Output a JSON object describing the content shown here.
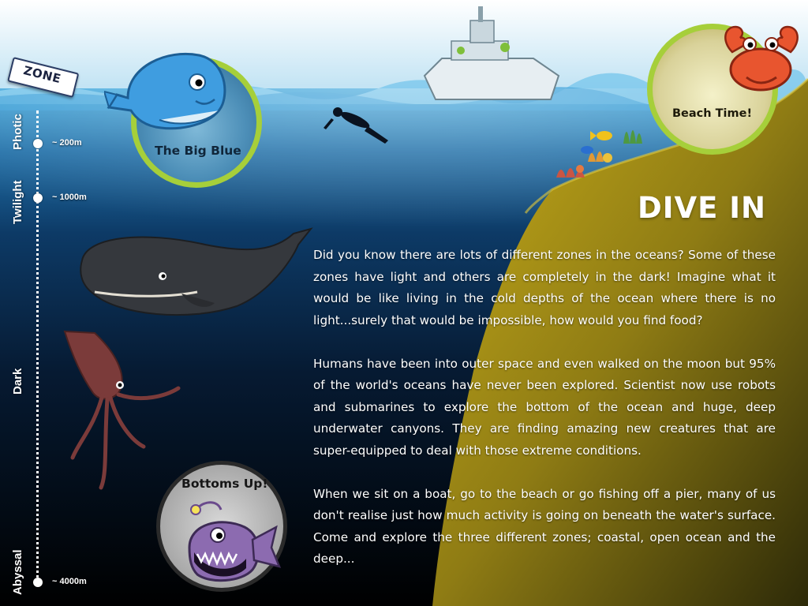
{
  "zone_tag": "ZONE",
  "zones": [
    {
      "name": "Photic",
      "depth": "~ 200m"
    },
    {
      "name": "Twilight",
      "depth": "~ 1000m"
    },
    {
      "name": "Dark",
      "depth": ""
    },
    {
      "name": "Abyssal",
      "depth": "~ 4000m"
    }
  ],
  "nav": {
    "big_blue": "The Big Blue",
    "beach_time": "Beach Time!",
    "bottoms_up": "Bottoms Up!"
  },
  "headline": "DIVE IN",
  "paragraphs": [
    "Did you know there are lots of different zones in the oceans?  Some of these zones have light and others are completely in the dark!  Imagine what it would be like living in the cold depths of the ocean where there is no light...surely that would be impossible, how would you find food?",
    "Humans have been into outer space and even walked on the moon but 95% of the world's oceans have never been explored.  Scientist now use robots and submarines to explore the bottom of the ocean and huge, deep underwater canyons.  They are finding amazing new creatures that are super-equipped to deal with those extreme conditions.",
    "When we sit on a boat, go to the beach or go fishing off a pier, many of us don't realise just how much activity is going on beneath the water's surface.  Come and explore the three different zones; coastal, open ocean and the deep..."
  ],
  "colors": {
    "sky_top": "#cfe9f6",
    "water_surface": "#3a9fd8",
    "deep_water": "#05101c",
    "seabed": "#b8a017",
    "ring_green": "#a6cf3a"
  },
  "icons": [
    "whale-icon",
    "crab-icon",
    "anglerfish-icon",
    "sperm-whale-icon",
    "squid-icon",
    "diver-icon",
    "ship-icon"
  ]
}
